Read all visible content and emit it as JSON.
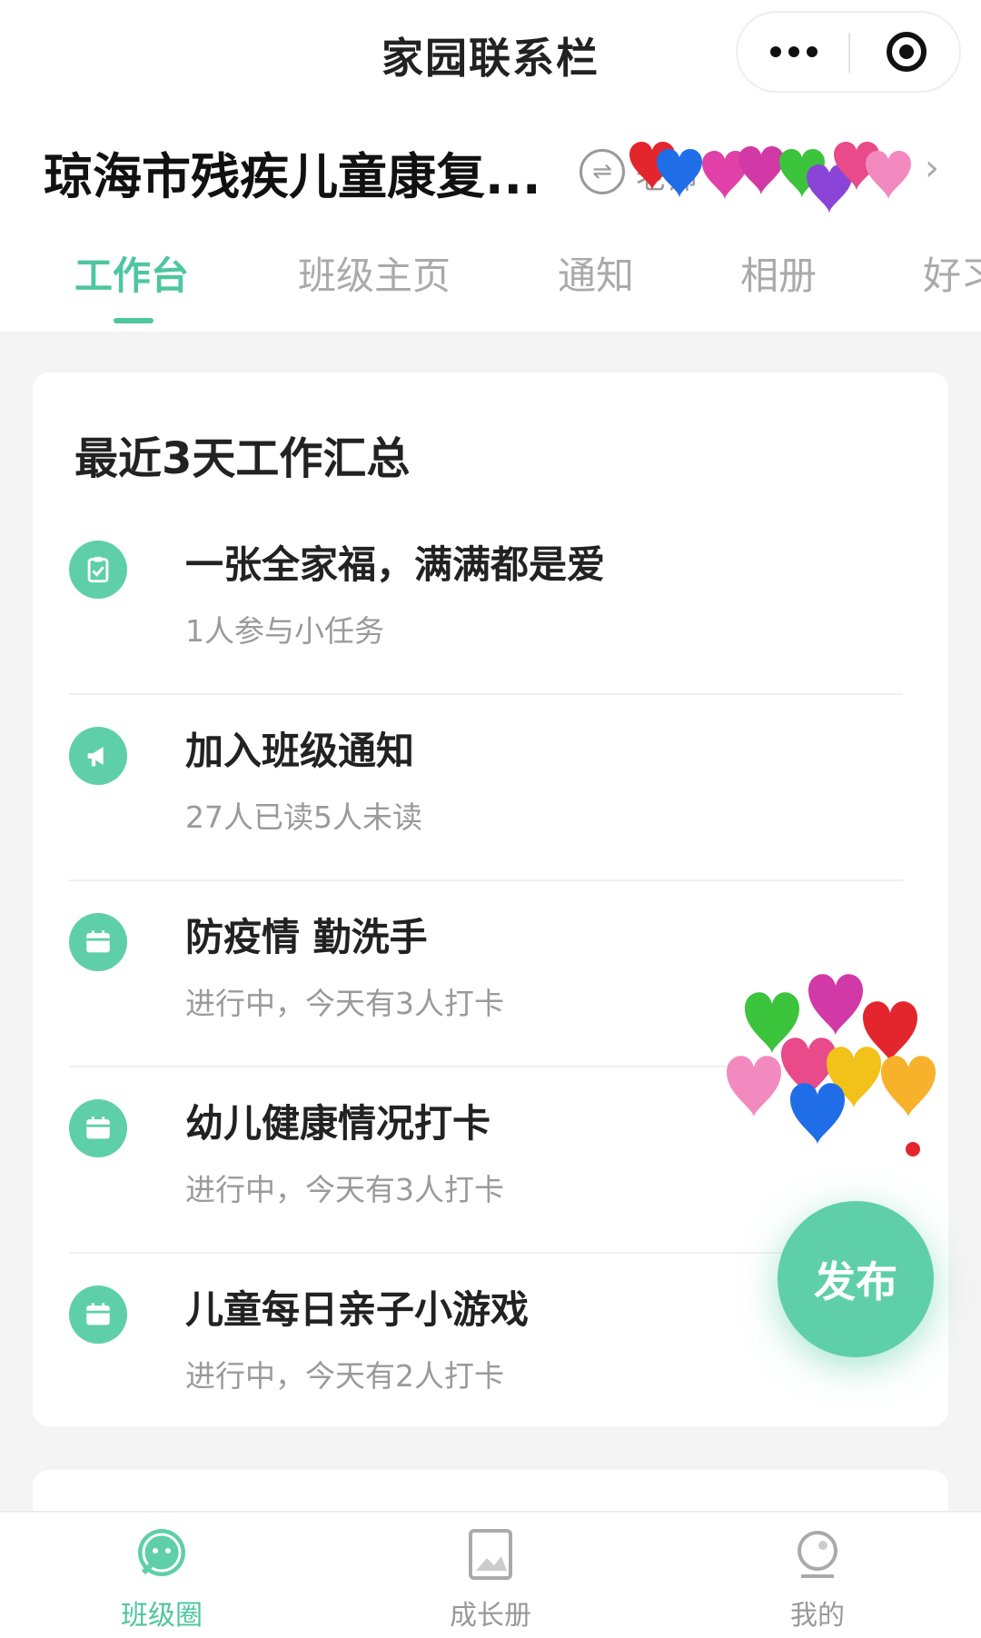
{
  "nav": {
    "title": "家园联系栏"
  },
  "header": {
    "school": "琼海市残疾儿童康复...",
    "switch_text": "老师"
  },
  "tabs": [
    "工作台",
    "班级主页",
    "通知",
    "相册",
    "好习"
  ],
  "summary": {
    "title": "最近3天工作汇总",
    "items": [
      {
        "title": "一张全家福，满满都是爱",
        "subtitle": "1人参与小任务",
        "icon": "clipboard-icon"
      },
      {
        "title": "加入班级通知",
        "subtitle": "27人已读5人未读",
        "icon": "megaphone-icon"
      },
      {
        "title": "防疫情 勤洗手",
        "subtitle": "进行中，今天有3人打卡",
        "icon": "calendar-icon"
      },
      {
        "title": "幼儿健康情况打卡",
        "subtitle": "进行中，今天有3人打卡",
        "icon": "calendar-icon"
      },
      {
        "title": "儿童每日亲子小游戏",
        "subtitle": "进行中，今天有2人打卡",
        "icon": "calendar-icon"
      }
    ]
  },
  "fab": {
    "label": "发布"
  },
  "bottom_nav": [
    {
      "label": "班级圈",
      "icon": "chat-bubble-icon",
      "active": true
    },
    {
      "label": "成长册",
      "icon": "album-icon",
      "active": false
    },
    {
      "label": "我的",
      "icon": "profile-icon",
      "active": false
    }
  ],
  "colors": {
    "accent": "#4ec69f",
    "icon_bg": "#5fcfa9"
  }
}
